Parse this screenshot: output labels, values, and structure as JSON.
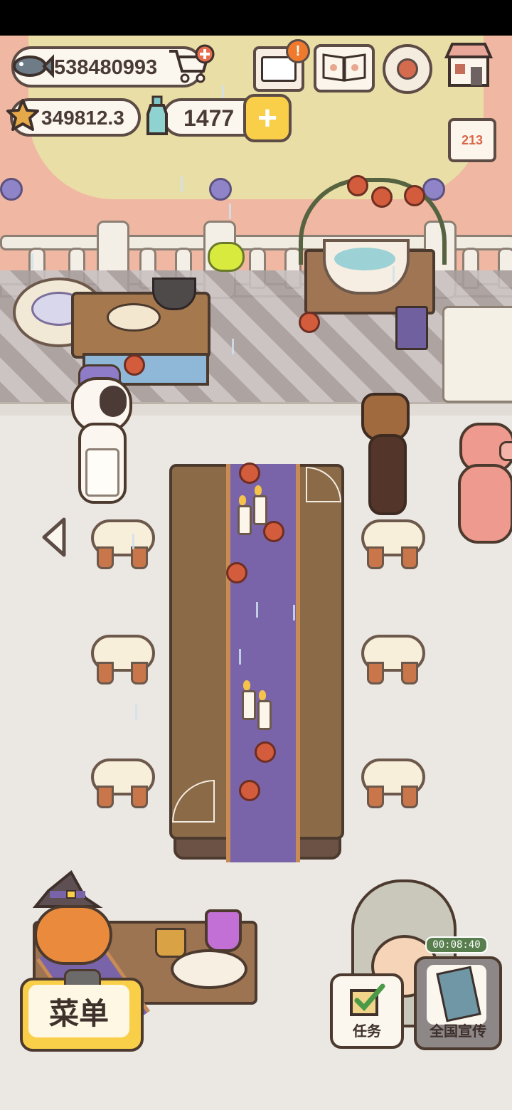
{
  "hud": {
    "fish_currency": "538480993",
    "star_currency": "349812.3",
    "bottle_currency": "1477",
    "plus_label": "+",
    "mail_badge": "!",
    "rank_label": "213"
  },
  "oven": {
    "timer": "00:08:40"
  },
  "buttons": {
    "menu_label": "菜单",
    "task_label": "任务",
    "promo_label": "全国宣传"
  },
  "icons": {
    "fish": "fish-icon",
    "cart": "cart-add-icon",
    "star": "star-icon",
    "bottle": "bottle-icon",
    "mail": "mail-icon",
    "book": "recipe-book-icon",
    "settings": "gear-icon",
    "shop": "shop-icon",
    "rank": "ranking-podium-icon",
    "nav_left": "left-arrow-icon",
    "task": "checkbox-icon",
    "promo": "magazine-icon"
  },
  "colors": {
    "accent_yellow": "#f9cf4a",
    "outline_brown": "#4c3a2e",
    "runner_purple": "#7a64a9",
    "timer_green": "#577e4c"
  }
}
